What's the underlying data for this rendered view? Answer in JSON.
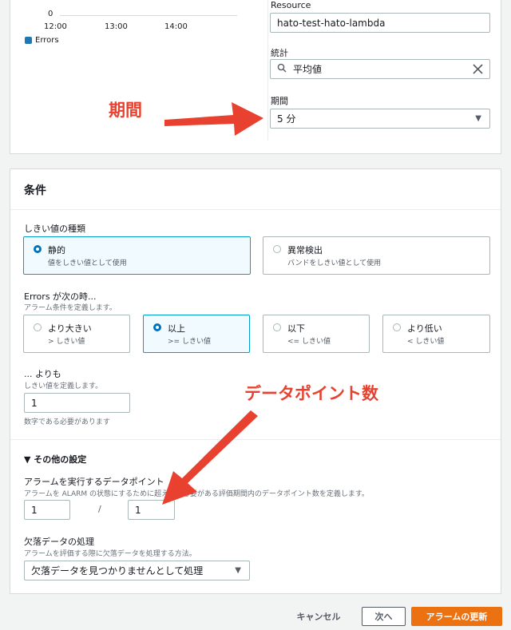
{
  "chart": {
    "zero_tick": "0",
    "x_ticks": [
      "12:00",
      "13:00",
      "14:00"
    ],
    "legend": "Errors",
    "legend_color": "#1f77b4"
  },
  "metric": {
    "resource_label": "Resource",
    "resource_value": "hato-test-hato-lambda",
    "statistic_label": "統計",
    "statistic_value": "平均値",
    "period_label": "期間",
    "period_value": "5 分"
  },
  "conditions": {
    "title": "条件",
    "threshold_type_label": "しきい値の種類",
    "threshold_types": [
      {
        "title": "静的",
        "sub": "値をしきい値として使用",
        "selected": true
      },
      {
        "title": "異常検出",
        "sub": "バンドをしきい値として使用",
        "selected": false
      }
    ],
    "when_label": "Errors が次の時...",
    "when_desc": "アラーム条件を定義します。",
    "operators": [
      {
        "title": "より大きい",
        "sub": "> しきい値",
        "selected": false
      },
      {
        "title": "以上",
        "sub": ">= しきい値",
        "selected": true
      },
      {
        "title": "以下",
        "sub": "<= しきい値",
        "selected": false
      },
      {
        "title": "より低い",
        "sub": "< しきい値",
        "selected": false
      }
    ],
    "than_label": "... よりも",
    "than_desc": "しきい値を定義します。",
    "threshold_value": "1",
    "threshold_hint": "数字である必要があります"
  },
  "additional": {
    "toggle_label": "▼ その他の設定",
    "datapoints_label": "アラームを実行するデータポイント",
    "datapoints_desc": "アラームを ALARM の状態にするために超えるる必要がある評価期間内のデータポイント数を定義します。",
    "datapoints_value": "1",
    "slash": "/",
    "evaluation_value": "1",
    "missing_label": "欠落データの処理",
    "missing_desc": "アラームを評価する際に欠落データを処理する方法。",
    "missing_value": "欠落データを見つかりませんとして処理"
  },
  "footer": {
    "cancel": "キャンセル",
    "next": "次へ",
    "update": "アラームの更新"
  },
  "annotations": {
    "period": "期間",
    "datapoints": "データポイント数",
    "color": "#e8412f"
  }
}
